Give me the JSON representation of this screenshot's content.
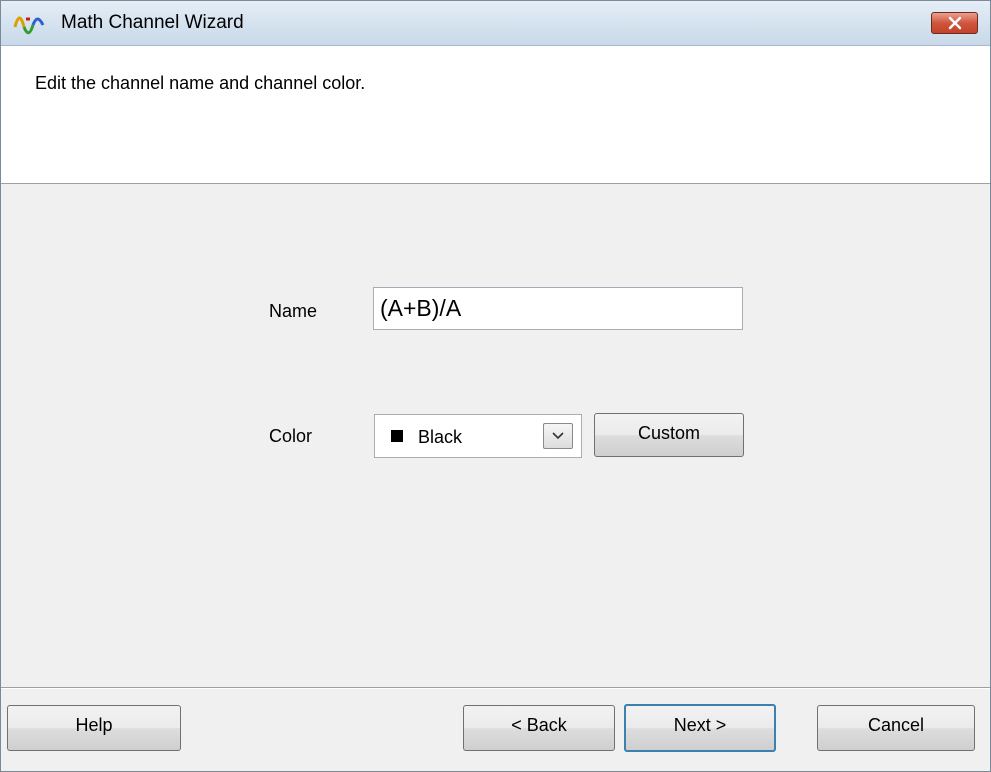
{
  "window": {
    "title": "Math Channel Wizard",
    "close_glyph": "✕"
  },
  "header": {
    "instruction": "Edit the channel name and channel color."
  },
  "form": {
    "name_label": "Name",
    "name_value": "(A+B)/A",
    "color_label": "Color",
    "color_selected": "Black",
    "color_swatch": "#000000",
    "custom_label": "Custom"
  },
  "footer": {
    "help_label": "Help",
    "back_label": "< Back",
    "next_label": "Next >",
    "cancel_label": "Cancel"
  }
}
